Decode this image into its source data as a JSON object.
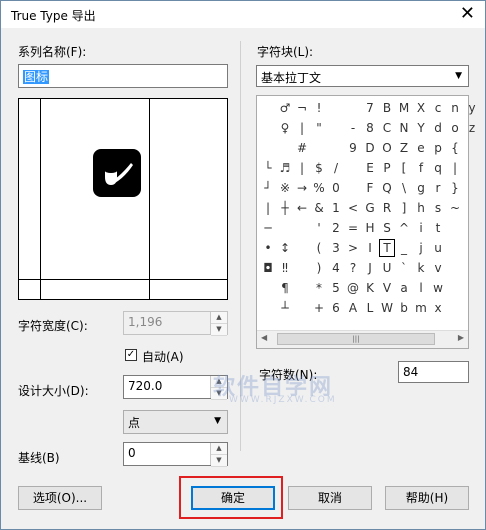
{
  "window": {
    "title": "True Type 导出"
  },
  "left": {
    "family_label": "系列名称(F):",
    "family_value": "图标",
    "char_width_label": "字符宽度(C):",
    "char_width_value": "1,196",
    "auto_label": "自动(A)",
    "auto_checked": true,
    "design_size_label": "设计大小(D):",
    "design_size_value": "720.0",
    "unit_value": "点",
    "baseline_label": "基线(B)",
    "baseline_value": "0"
  },
  "right": {
    "charset_label": "字符块(L):",
    "charset_value": "基本拉丁文",
    "char_num_label": "字符数(N):",
    "char_num_value": "84",
    "char_rows": [
      [
        "",
        "♂",
        "¬",
        "!",
        "",
        "",
        "7",
        "B",
        "M",
        "X",
        "c",
        "n",
        "y"
      ],
      [
        "",
        "♀",
        "|",
        "\"",
        "",
        "-",
        "8",
        "C",
        "N",
        "Y",
        "d",
        "o",
        "z"
      ],
      [
        "",
        "",
        "#",
        "",
        "",
        "9",
        "D",
        "O",
        "Z",
        "e",
        "p",
        "{"
      ],
      [
        "└",
        "♬",
        "|",
        "$",
        "/",
        "",
        "E",
        "P",
        "[",
        "f",
        "q",
        "|"
      ],
      [
        "┘",
        "※",
        "→",
        "%",
        "0",
        "",
        "F",
        "Q",
        "\\",
        "g",
        "r",
        "}"
      ],
      [
        "|",
        "┼",
        "←",
        "&",
        "1",
        "<",
        "G",
        "R",
        "]",
        "h",
        "s",
        "~"
      ],
      [
        "─",
        "",
        "",
        "'",
        "2",
        "=",
        "H",
        "S",
        "^",
        "i",
        "t",
        ""
      ],
      [
        "•",
        "↕",
        "",
        "(",
        "3",
        ">",
        "I",
        "T",
        "_",
        "j",
        "u",
        ""
      ],
      [
        "◘",
        "‼",
        "",
        ")",
        "4",
        "?",
        "J",
        "U",
        "`",
        "k",
        "v",
        ""
      ],
      [
        "",
        "¶",
        "",
        "*",
        "5",
        "@",
        "K",
        "V",
        "a",
        "l",
        "w",
        ""
      ],
      [
        "",
        "┴",
        "",
        "+",
        "6",
        "A",
        "L",
        "W",
        "b",
        "m",
        "x",
        ""
      ]
    ],
    "selected_char": "T"
  },
  "buttons": {
    "options": "选项(O)...",
    "ok": "确定",
    "cancel": "取消",
    "help": "帮助(H)"
  },
  "icons": {
    "close": "close-icon",
    "dropdown": "chevron-down-icon"
  }
}
